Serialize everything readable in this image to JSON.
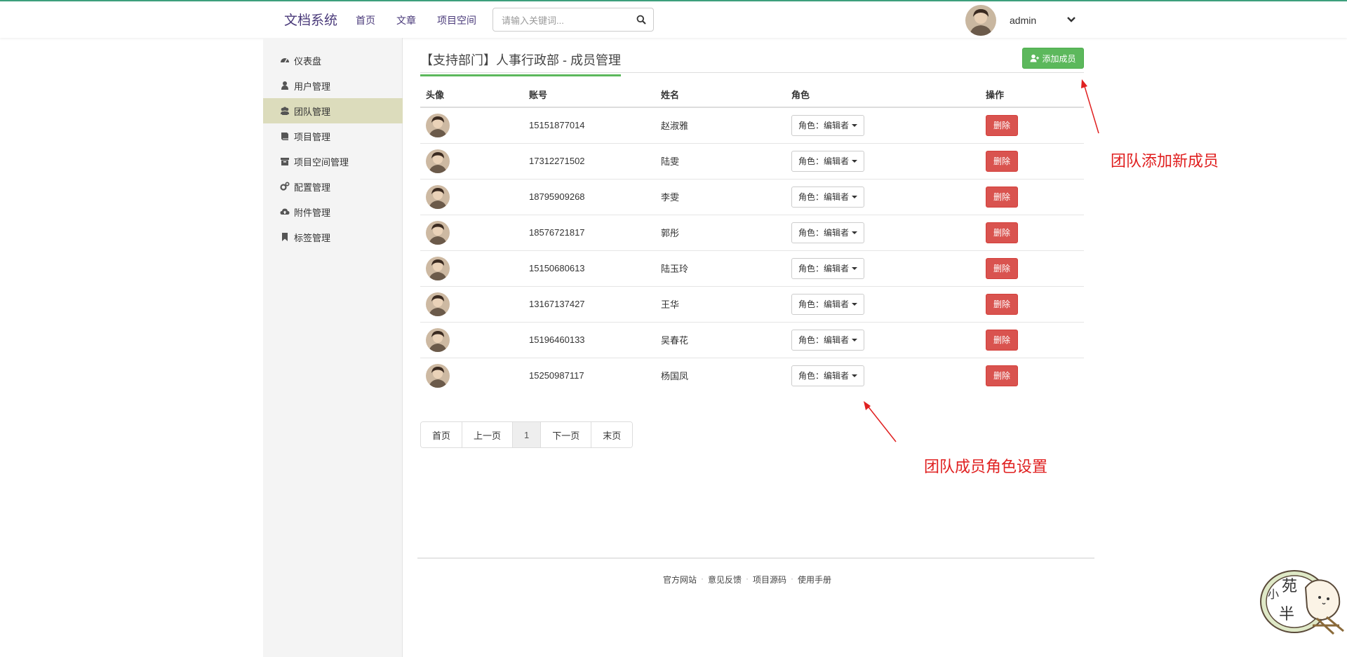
{
  "app": {
    "brand": "文档系统"
  },
  "nav": {
    "items": [
      "首页",
      "文章",
      "项目空间"
    ]
  },
  "search": {
    "placeholder": "请输入关键词..."
  },
  "user": {
    "name": "admin"
  },
  "sidebar": {
    "items": [
      {
        "label": "仪表盘",
        "icon": "dashboard-icon"
      },
      {
        "label": "用户管理",
        "icon": "user-icon"
      },
      {
        "label": "团队管理",
        "icon": "users-icon",
        "active": true
      },
      {
        "label": "项目管理",
        "icon": "book-icon"
      },
      {
        "label": "项目空间管理",
        "icon": "archive-icon"
      },
      {
        "label": "配置管理",
        "icon": "cogs-icon"
      },
      {
        "label": "附件管理",
        "icon": "cloud-upload-icon"
      },
      {
        "label": "标签管理",
        "icon": "bookmark-icon"
      }
    ]
  },
  "page": {
    "title": "【支持部门】人事行政部 - 成员管理",
    "add_button": "添加成员"
  },
  "table": {
    "headers": [
      "头像",
      "账号",
      "姓名",
      "角色",
      "操作"
    ],
    "rows": [
      {
        "account": "15151877014",
        "name": "赵淑雅",
        "role": "角色：编辑者",
        "action": "删除"
      },
      {
        "account": "17312271502",
        "name": "陆雯",
        "role": "角色：编辑者",
        "action": "删除"
      },
      {
        "account": "18795909268",
        "name": "李雯",
        "role": "角色：编辑者",
        "action": "删除"
      },
      {
        "account": "18576721817",
        "name": "郭彤",
        "role": "角色：编辑者",
        "action": "删除"
      },
      {
        "account": "15150680613",
        "name": "陆玉玲",
        "role": "角色：编辑者",
        "action": "删除"
      },
      {
        "account": "13167137427",
        "name": "王华",
        "role": "角色：编辑者",
        "action": "删除"
      },
      {
        "account": "15196460133",
        "name": "吴春花",
        "role": "角色：编辑者",
        "action": "删除"
      },
      {
        "account": "15250987117",
        "name": "杨国凤",
        "role": "角色：编辑者",
        "action": "删除"
      }
    ]
  },
  "pagination": {
    "first": "首页",
    "prev": "上一页",
    "current": "1",
    "next": "下一页",
    "last": "末页"
  },
  "footer": {
    "links": [
      "官方网站",
      "意见反馈",
      "项目源码",
      "使用手册"
    ],
    "separator": "·"
  },
  "annotations": {
    "add_member": "团队添加新成员",
    "role_setting": "团队成员角色设置"
  },
  "sticker": {
    "text_top": "苑",
    "text_left": "小",
    "text_bottom": "半"
  },
  "colors": {
    "accent_green": "#5cb85c",
    "danger_red": "#d9534f",
    "sidebar_active": "#dcdcbc",
    "annotation_red": "#e02020",
    "brand_purple": "#4a3a7a"
  }
}
